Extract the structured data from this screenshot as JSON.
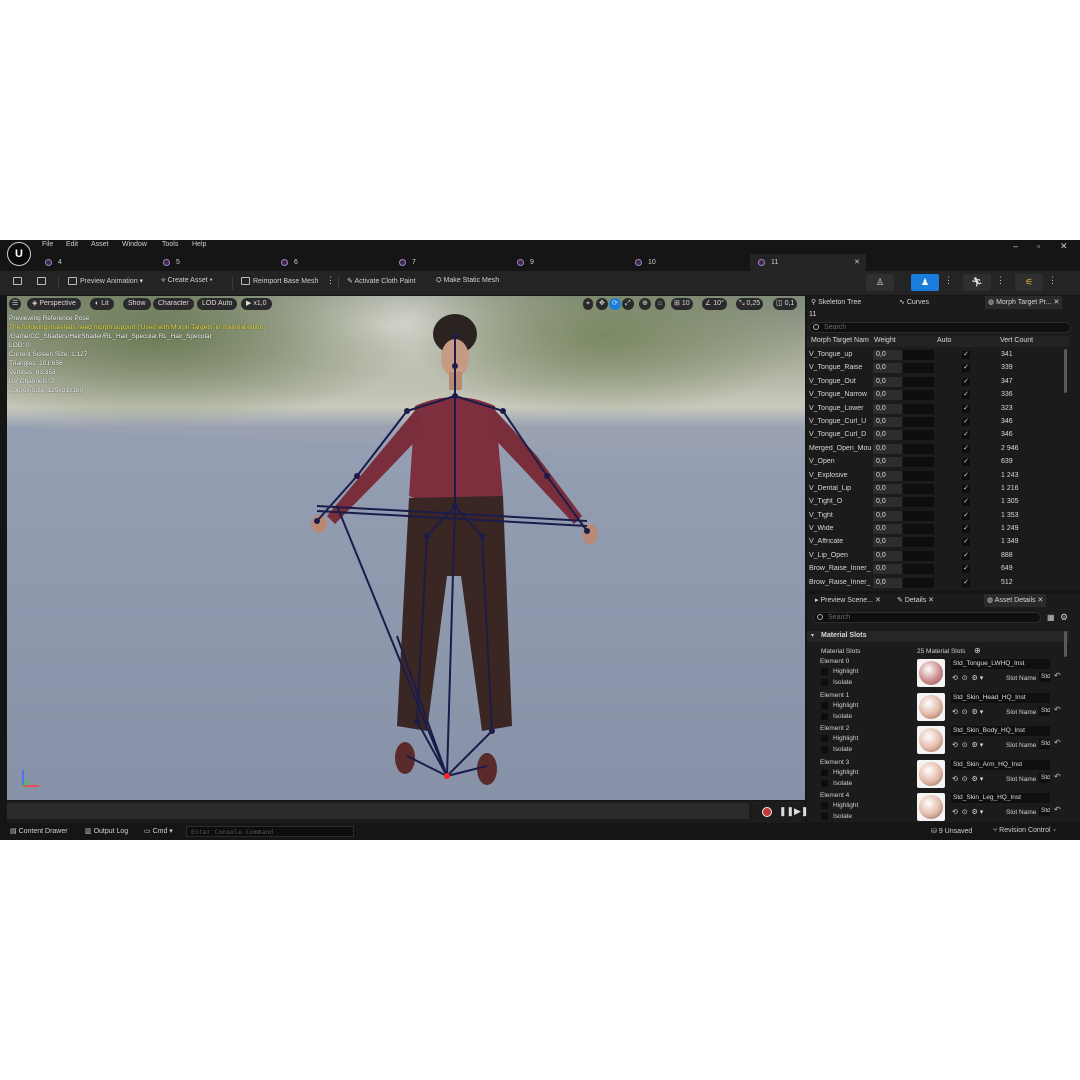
{
  "app": {
    "logo_text": "U"
  },
  "menu": [
    "File",
    "Edit",
    "Asset",
    "Window",
    "Tools",
    "Help"
  ],
  "tabs": [
    "4",
    "5",
    "6",
    "7",
    "9",
    "10",
    "11"
  ],
  "toolbar": {
    "preview_animation": "Preview Animation",
    "create_asset": "Create Asset",
    "reimport_base_mesh": "Reimport Base Mesh",
    "activate_cloth_paint": "Activate Cloth Paint",
    "make_static_mesh": "Make Static Mesh"
  },
  "viewport": {
    "perspective": "Perspective",
    "lit": "Lit",
    "show": "Show",
    "character": "Character",
    "lod": "LOD Auto",
    "speed": "x1,0",
    "grid_value": "10",
    "angle_value": "10°",
    "scale_value": "0,25",
    "camera_speed": "0,1",
    "info_lines": [
      "Previewing Reference Pose",
      "The following materials need morph support ('Used with Morph Targets' in material editor):",
      "/Game/CC_Shaders/HairShader/RL_Hair_Specular.RL_Hair_Specular",
      "LOD: 0",
      "Current Screen Size: 1,127",
      "Triangles: 101 656",
      "Vertices: 83 353",
      "UV Channels: 2",
      "Approx Size: 129x31x180"
    ]
  },
  "right_top": {
    "tabs": [
      "Skeleton Tree",
      "Curves",
      "Morph Target Pr..."
    ],
    "count": "11",
    "search_placeholder": "Search",
    "columns": [
      "Morph Target Nam",
      "Weight",
      "Auto",
      "Vert Count"
    ],
    "rows": [
      {
        "name": "V_Tongue_up",
        "weight": "0,0",
        "auto": true,
        "verts": "341"
      },
      {
        "name": "V_Tongue_Raise",
        "weight": "0,0",
        "auto": true,
        "verts": "339"
      },
      {
        "name": "V_Tongue_Out",
        "weight": "0,0",
        "auto": true,
        "verts": "347"
      },
      {
        "name": "V_Tongue_Narrow",
        "weight": "0,0",
        "auto": true,
        "verts": "336"
      },
      {
        "name": "V_Tongue_Lower",
        "weight": "0,0",
        "auto": true,
        "verts": "323"
      },
      {
        "name": "V_Tongue_Curl_U",
        "weight": "0,0",
        "auto": true,
        "verts": "346"
      },
      {
        "name": "V_Tongue_Curl_D",
        "weight": "0,0",
        "auto": true,
        "verts": "346"
      },
      {
        "name": "Merged_Open_Mouth",
        "weight": "0,0",
        "auto": true,
        "verts": "2 946"
      },
      {
        "name": "V_Open",
        "weight": "0,0",
        "auto": true,
        "verts": "639"
      },
      {
        "name": "V_Explosive",
        "weight": "0,0",
        "auto": true,
        "verts": "1 243"
      },
      {
        "name": "V_Dental_Lip",
        "weight": "0,0",
        "auto": true,
        "verts": "1 216"
      },
      {
        "name": "V_Tight_O",
        "weight": "0,0",
        "auto": true,
        "verts": "1 305"
      },
      {
        "name": "V_Tight",
        "weight": "0,0",
        "auto": true,
        "verts": "1 353"
      },
      {
        "name": "V_Wide",
        "weight": "0,0",
        "auto": true,
        "verts": "1 249"
      },
      {
        "name": "V_Affricate",
        "weight": "0,0",
        "auto": true,
        "verts": "1 349"
      },
      {
        "name": "V_Lip_Open",
        "weight": "0,0",
        "auto": true,
        "verts": "888"
      },
      {
        "name": "Brow_Raise_Inner_L",
        "weight": "0,0",
        "auto": true,
        "verts": "649"
      },
      {
        "name": "Brow_Raise_Inner_R",
        "weight": "0,0",
        "auto": true,
        "verts": "512"
      }
    ]
  },
  "right_bottom": {
    "tabs": [
      "Preview Scene...",
      "Details",
      "Asset Details"
    ],
    "search_placeholder": "Search",
    "section_title": "Material Slots",
    "slots_label": "Material Slots",
    "slots_count": "25 Material Slots",
    "highlight_label": "Highlight",
    "isolate_label": "Isolate",
    "slot_name_label": "Slot Name",
    "elements": [
      {
        "label": "Element 0",
        "material": "Std_Tongue_LWHQ_Inst",
        "slot_name": "Std",
        "color": "#c98a8a"
      },
      {
        "label": "Element 1",
        "material": "Std_Skin_Head_HQ_Inst",
        "slot_name": "Std",
        "color": "#e0b7a5"
      },
      {
        "label": "Element 2",
        "material": "Std_Skin_Body_HQ_Inst",
        "slot_name": "Std",
        "color": "#e4bba9"
      },
      {
        "label": "Element 3",
        "material": "Std_Skin_Arm_HQ_Inst",
        "slot_name": "Std",
        "color": "#e3b9a7"
      },
      {
        "label": "Element 4",
        "material": "Std_Skin_Leg_HQ_Inst",
        "slot_name": "Std",
        "color": "#e2b8a6"
      }
    ]
  },
  "statusbar": {
    "content_drawer": "Content Drawer",
    "output_log": "Output Log",
    "cmd": "Cmd",
    "console_placeholder": "Enter Console Command",
    "unsaved": "9 Unsaved",
    "revision_control": "Revision Control"
  },
  "colors": {
    "accent": "#1a7ddc",
    "panel": "#1b1b1b",
    "bg": "#151515",
    "warning_text": "#f2e64a"
  }
}
